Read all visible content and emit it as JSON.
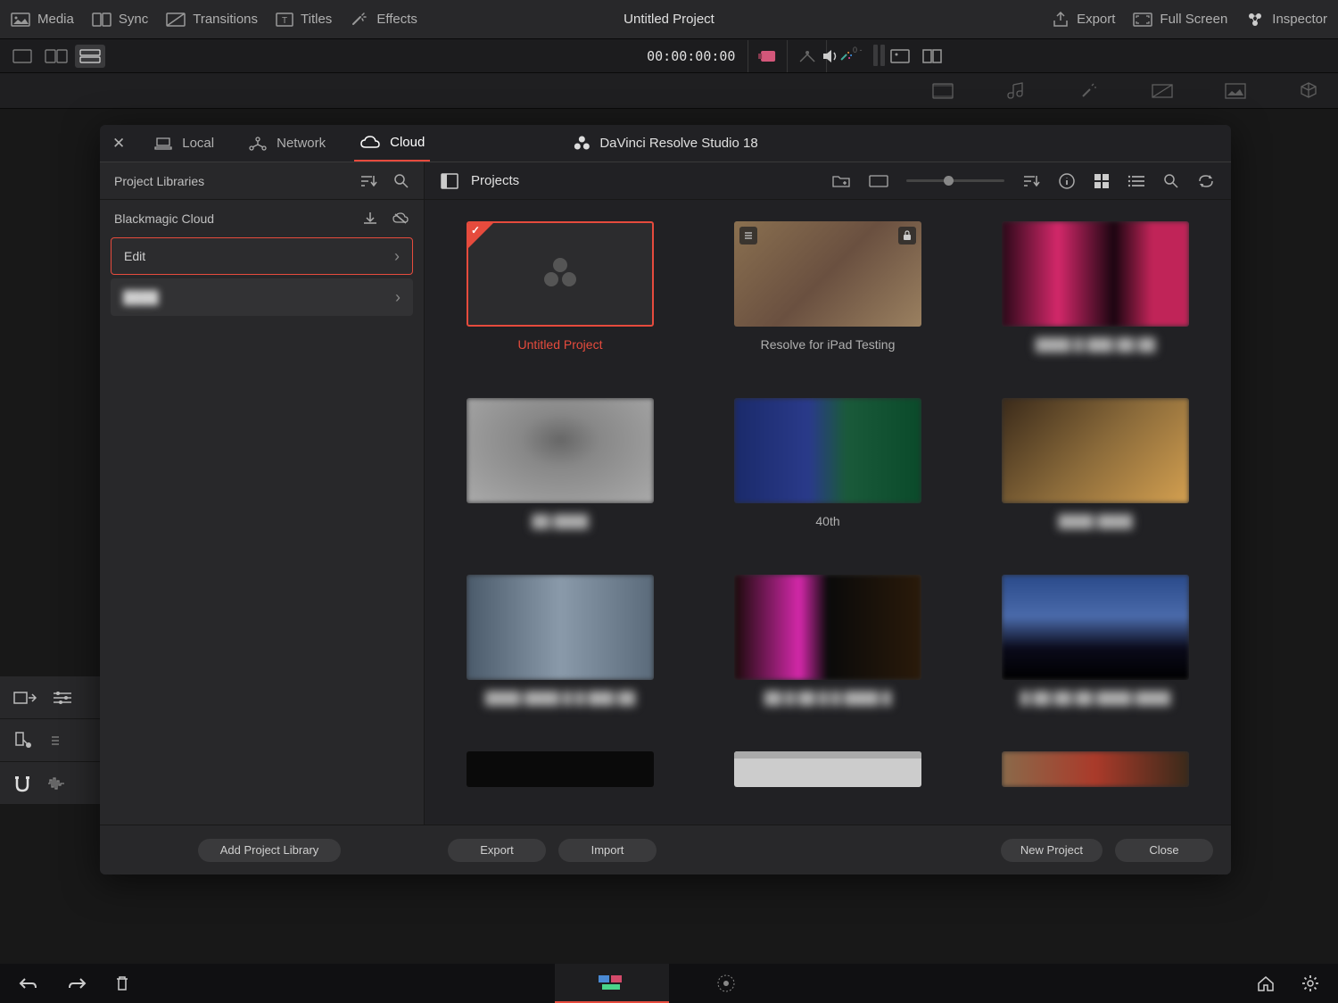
{
  "topbar": {
    "media": "Media",
    "sync": "Sync",
    "transitions": "Transitions",
    "titles": "Titles",
    "effects": "Effects",
    "project_title": "Untitled Project",
    "export": "Export",
    "fullscreen": "Full Screen",
    "inspector": "Inspector"
  },
  "toolbar": {
    "timecode": "00:00:00:00",
    "vu_label": "0 -"
  },
  "modal": {
    "tabs": {
      "local": "Local",
      "network": "Network",
      "cloud": "Cloud"
    },
    "app_title": "DaVinci Resolve Studio 18",
    "sidebar_header": "Project Libraries",
    "cloud_group": "Blackmagic Cloud",
    "libraries": [
      {
        "name": "Edit",
        "selected": true
      },
      {
        "name": "████",
        "selected": false,
        "blur": true
      }
    ],
    "main_header": "Projects",
    "projects": [
      {
        "name": "Untitled Project",
        "selected": true,
        "empty": true
      },
      {
        "name": "Resolve for iPad Testing",
        "locked": true,
        "stacked": true
      },
      {
        "name": "████ █ ███ ██ ██",
        "blur": true
      },
      {
        "name": "██ ████",
        "blur": true
      },
      {
        "name": "40th"
      },
      {
        "name": "████ ████",
        "blur": true
      },
      {
        "name": "████ ████\n█ █ ███ ██",
        "blur": true
      },
      {
        "name": "██ █ ██\n█ █ ████ █",
        "blur": true
      },
      {
        "name": "█ ██ ██ ██\n████ ████",
        "blur": true
      },
      {
        "name": "",
        "partial": true
      },
      {
        "name": "",
        "partial": true,
        "folder": true
      },
      {
        "name": "",
        "partial": true
      }
    ],
    "footer": {
      "add_library": "Add Project Library",
      "export": "Export",
      "import": "Import",
      "new_project": "New Project",
      "close": "Close"
    }
  }
}
